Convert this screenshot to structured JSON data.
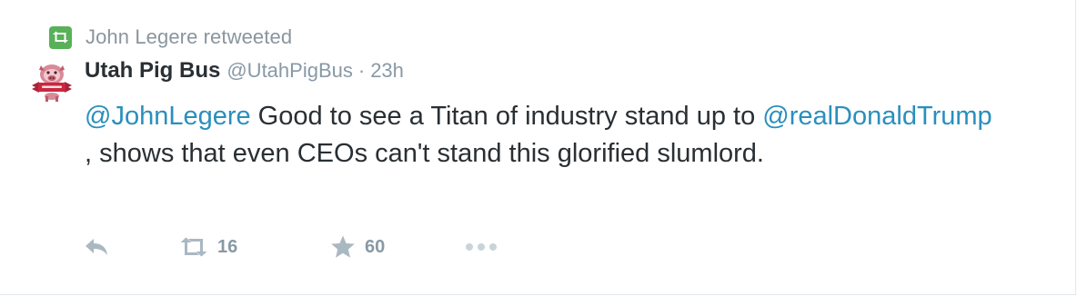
{
  "retweet_context": {
    "text": "John Legere retweeted",
    "badge_color": "#58b158"
  },
  "author": {
    "display_name": "Utah Pig Bus",
    "handle": "@UtahPigBus",
    "separator": "·",
    "timestamp": "23h",
    "avatar_icon": "pig-logo-avatar"
  },
  "tweet": {
    "mention_1": "@JohnLegere",
    "text_1": " Good to see a Titan of industry stand up to ",
    "mention_2": "@realDonaldTrump",
    "text_2": " , shows that even CEOs can't stand this glorified slumlord."
  },
  "actions": {
    "reply_icon": "reply-icon",
    "retweet_icon": "retweet-icon",
    "retweet_count": "16",
    "like_icon": "star-icon",
    "like_count": "60",
    "more_icon": "more-dots-icon"
  },
  "colors": {
    "link": "#2a8fbd",
    "muted": "#8899a6",
    "text": "#292f33",
    "action_icon": "#aab8c2"
  }
}
